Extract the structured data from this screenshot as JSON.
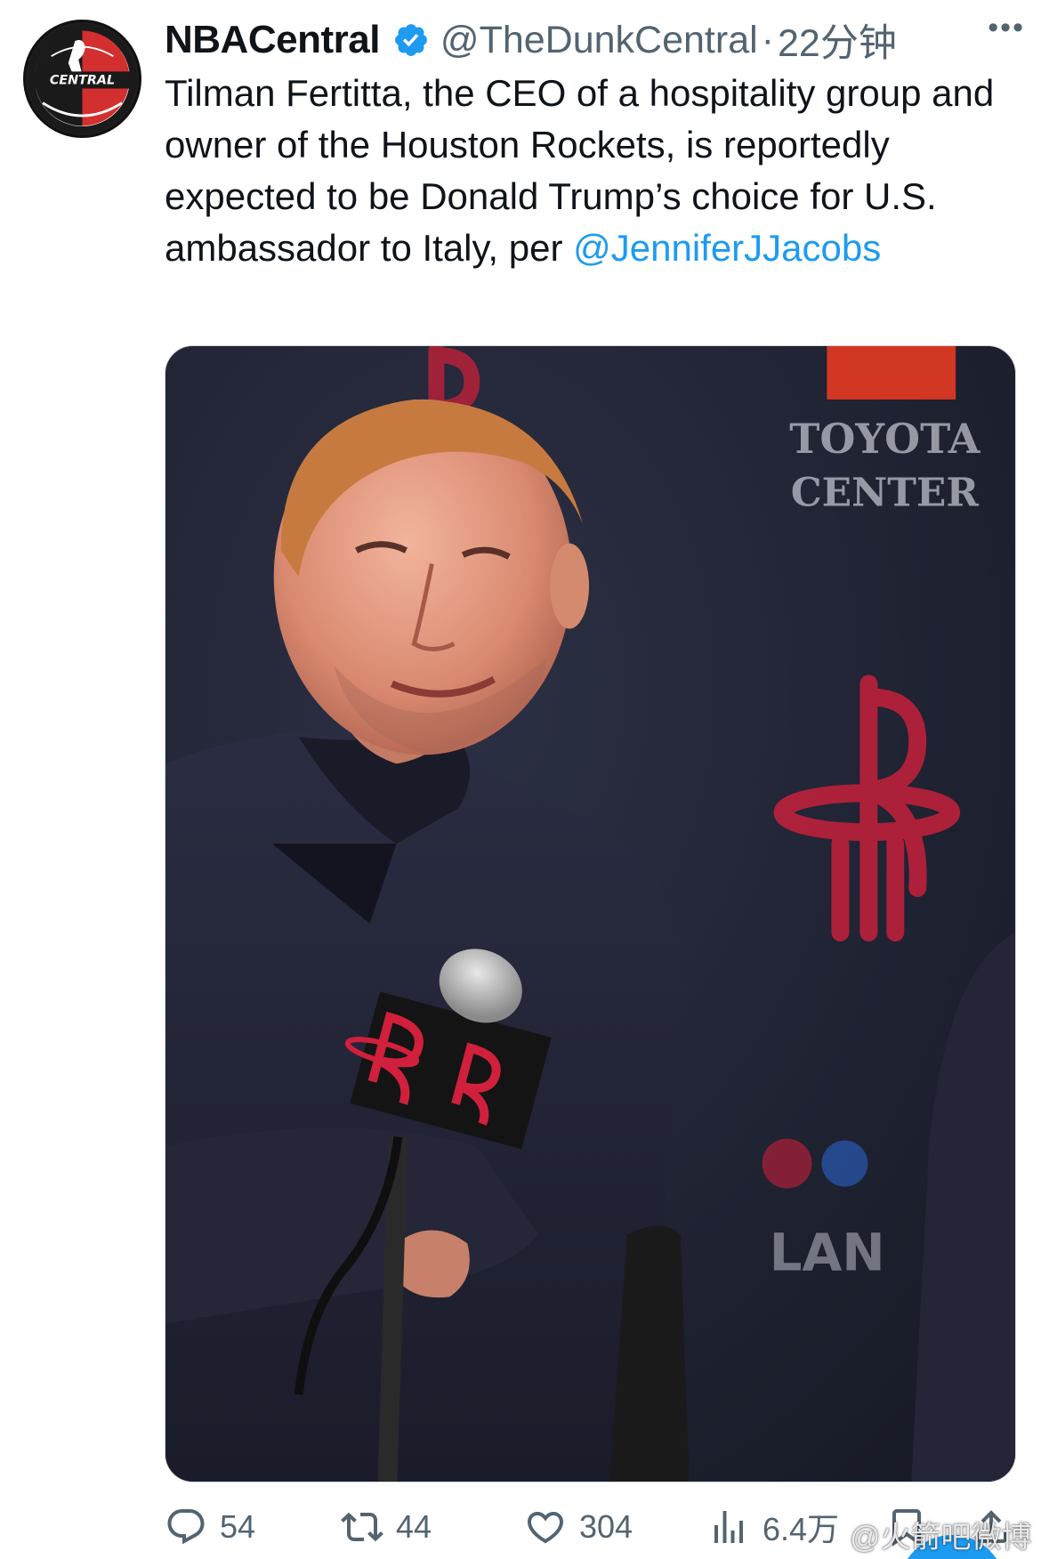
{
  "author": {
    "display_name": "NBACentral",
    "handle": "@TheDunkCentral",
    "separator": "·",
    "time": "22分钟",
    "avatar_text": "CENTRAL",
    "verified": true
  },
  "tweet": {
    "text": "Tilman Fertitta, the CEO of a hospitality group and owner of the Houston Rockets, is reportedly expected to be Donald Trump’s choice for U.S. ambassador to Italy, per ",
    "mention": "@JenniferJJacobs"
  },
  "media": {
    "backdrop_text_1": "TOYOTA",
    "backdrop_text_2": "CENTER"
  },
  "actions": {
    "replies": "54",
    "retweets": "44",
    "likes": "304",
    "views": "6.4万"
  },
  "watermark": "@火箭吧微博",
  "colors": {
    "accent": "#1d9bf0",
    "muted": "#536471",
    "rockets_red": "#ce1141"
  },
  "icons": [
    "more-icon",
    "verified-icon",
    "reply-icon",
    "retweet-icon",
    "like-icon",
    "views-icon",
    "bookmark-icon",
    "share-icon"
  ]
}
